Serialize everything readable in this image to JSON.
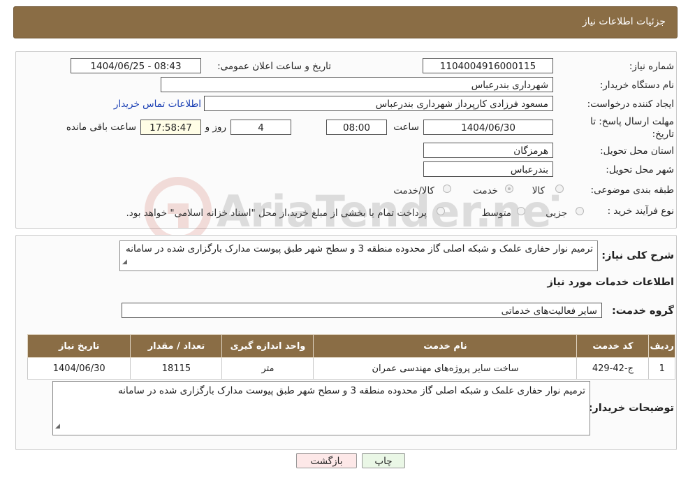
{
  "header": {
    "title": "جزئیات اطلاعات نیاز"
  },
  "fields": {
    "need_number_label": "شماره نیاز:",
    "need_number": "1104004916000115",
    "announce_label": "تاریخ و ساعت اعلان عمومی:",
    "announce_value": "1404/06/25 - 08:43",
    "buyer_org_label": "نام دستگاه خریدار:",
    "buyer_org": "شهرداری بندرعباس",
    "requester_label": "ایجاد کننده درخواست:",
    "requester": "مسعود فرزادی کارپرداز شهرداری بندرعباس",
    "contact_link": "اطلاعات تماس خریدار",
    "deadline_label_1": "مهلت ارسال پاسخ: تا",
    "deadline_label_2": "تاریخ:",
    "deadline_date": "1404/06/30",
    "time_label": "ساعت",
    "deadline_time": "08:00",
    "days_value": "4",
    "days_label": "روز و",
    "remaining_time": "17:58:47",
    "remaining_label": "ساعت باقی مانده",
    "province_label": "استان محل تحویل:",
    "province": "هرمزگان",
    "city_label": "شهر محل تحویل:",
    "city": "بندرعباس",
    "category_label": "طبقه بندی موضوعی:",
    "category_options": [
      "کالا",
      "خدمت",
      "کالا/خدمت"
    ],
    "category_selected": "خدمت",
    "process_label": "نوع فرآیند خرید :",
    "process_options": [
      "جزیی",
      "متوسط"
    ],
    "process_note": "پرداخت تمام یا بخشی از مبلغ خرید،از محل \"اسناد خزانه اسلامی\" خواهد بود."
  },
  "summary": {
    "label": "شرح کلی نیاز:",
    "text": "ترمیم نوار حفاری علمک و شبکه اصلی گاز محدوده منطقه 3 و سطح شهر طبق پیوست مدارک بارگزاری شده در سامانه",
    "services_title": "اطلاعات خدمات مورد نیاز",
    "group_label": "گروه خدمت:",
    "group_value": "سایر فعالیت‌های خدماتی"
  },
  "table": {
    "headers": [
      "ردیف",
      "کد خدمت",
      "نام خدمت",
      "واحد اندازه گیری",
      "تعداد / مقدار",
      "تاریخ نیاز"
    ],
    "rows": [
      [
        "1",
        "ج-42-429",
        "ساخت سایر پروژه‌های مهندسی عمران",
        "متر",
        "18115",
        "1404/06/30"
      ]
    ]
  },
  "buyer_notes": {
    "label": "توضیحات خریدار:",
    "text": "ترمیم نوار حفاری علمک و شبکه اصلی گاز محدوده منطقه 3 و سطح شهر  طبق پیوست مدارک بارگزاری شده  در سامانه"
  },
  "buttons": {
    "print": "چاپ",
    "back": "بازگشت"
  },
  "watermark": "AriaTender.neT",
  "colors": {
    "header_bg": "#8a6d45",
    "link": "#1a3fb4",
    "back_button_bg": "#fde8e8",
    "print_button_bg": "#eaf7e6"
  }
}
